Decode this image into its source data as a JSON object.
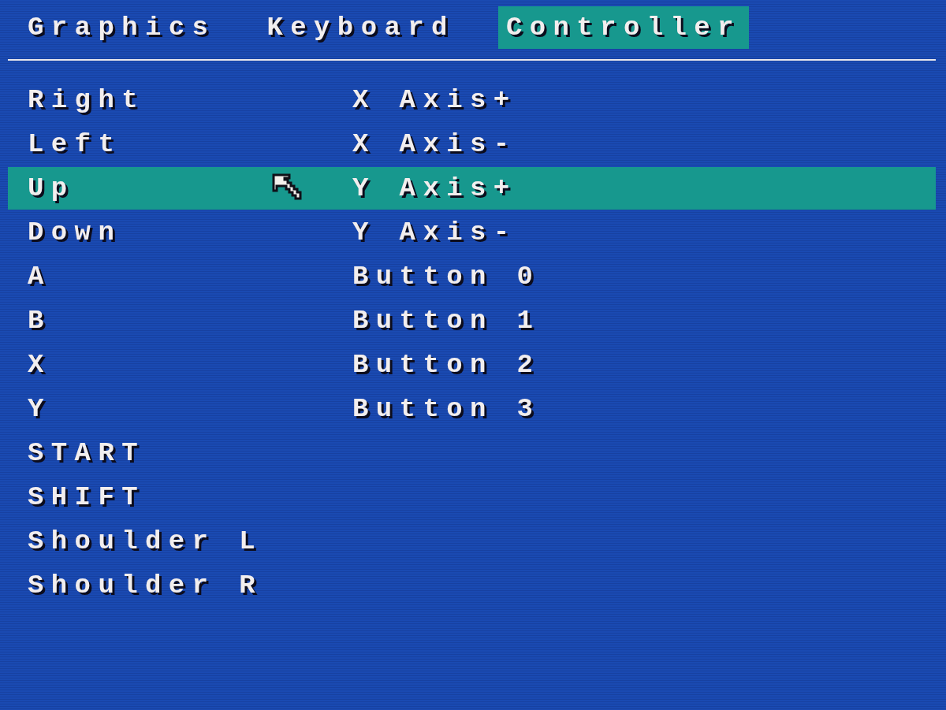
{
  "tabs": [
    {
      "label": "Graphics",
      "selected": false
    },
    {
      "label": "Keyboard",
      "selected": false
    },
    {
      "label": "Controller",
      "selected": true
    }
  ],
  "bindings": [
    {
      "action": "Right",
      "input": "X Axis+",
      "selected": false
    },
    {
      "action": "Left",
      "input": "X Axis-",
      "selected": false
    },
    {
      "action": "Up",
      "input": "Y Axis+",
      "selected": true
    },
    {
      "action": "Down",
      "input": "Y Axis-",
      "selected": false
    },
    {
      "action": "A",
      "input": "Button 0",
      "selected": false
    },
    {
      "action": "B",
      "input": "Button 1",
      "selected": false
    },
    {
      "action": "X",
      "input": "Button 2",
      "selected": false
    },
    {
      "action": "Y",
      "input": "Button 3",
      "selected": false
    },
    {
      "action": "START",
      "selected": false
    },
    {
      "action": "SHIFT",
      "selected": false
    },
    {
      "action": "Shoulder L",
      "selected": false
    },
    {
      "action": "Shoulder R",
      "selected": false
    }
  ]
}
